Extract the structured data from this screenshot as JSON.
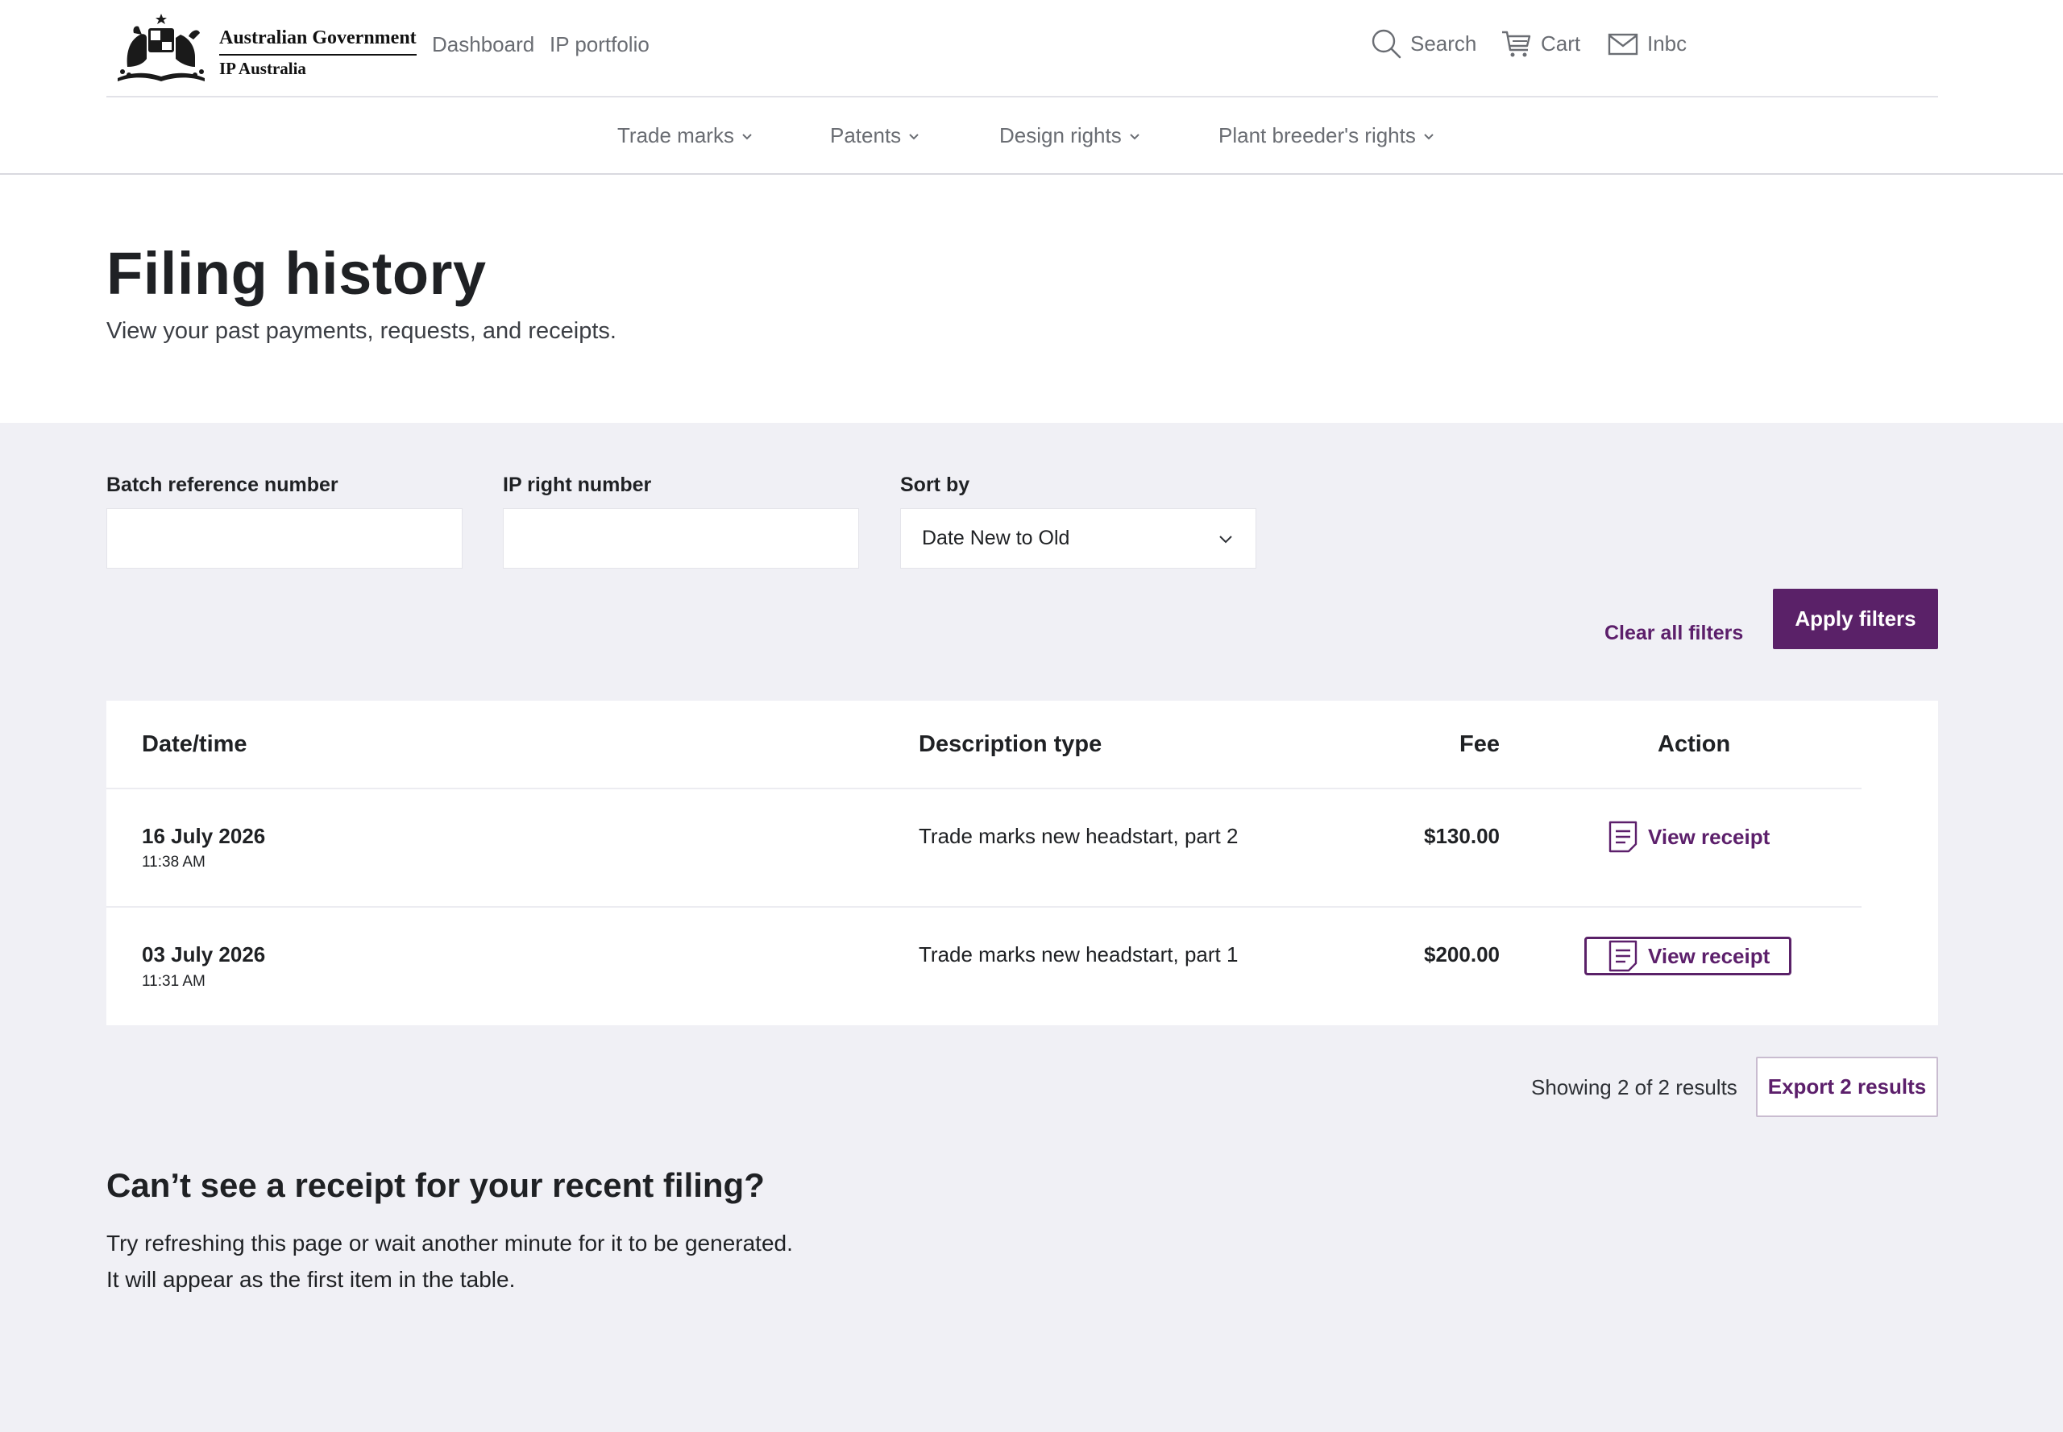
{
  "brand": {
    "line1": "Australian Government",
    "line2": "IP Australia",
    "crest_icon": "coat-of-arms"
  },
  "topnav": {
    "dashboard": "Dashboard",
    "portfolio": "IP portfolio",
    "search": "Search",
    "cart": "Cart",
    "inbox": "Inbc"
  },
  "mainnav": {
    "items": [
      {
        "label": "Trade marks",
        "icon": "chevron-down-icon"
      },
      {
        "label": "Patents",
        "icon": "chevron-down-icon"
      },
      {
        "label": "Design rights",
        "icon": "chevron-down-icon"
      },
      {
        "label": "Plant breeder's rights",
        "icon": "chevron-down-icon"
      }
    ]
  },
  "page": {
    "title": "Filing history",
    "subtitle": "View your past payments, requests, and receipts."
  },
  "filters": {
    "batch_label": "Batch reference number",
    "batch_value": "",
    "ip_label": "IP right number",
    "ip_value": "",
    "sort_label": "Sort by",
    "sort_value": "Date New to Old",
    "clear_label": "Clear all filters",
    "apply_label": "Apply filters"
  },
  "table": {
    "headers": {
      "date": "Date/time",
      "description": "Description type",
      "fee": "Fee",
      "action": "Action"
    },
    "rows": [
      {
        "date": "16 July 2026",
        "time": "11:38 AM",
        "description": "Trade marks new headstart, part 2",
        "fee": "$130.00",
        "action": "View receipt"
      },
      {
        "date": "03 July 2026",
        "time": "11:31 AM",
        "description": "Trade marks new headstart, part 1",
        "fee": "$200.00",
        "action": "View receipt"
      }
    ]
  },
  "results": {
    "showing": "Showing 2 of 2 results",
    "export_label": "Export 2 results"
  },
  "help": {
    "title": "Can’t see a receipt for your recent filing?",
    "line1": "Try refreshing this page or wait another minute for it to be generated.",
    "line2": "It will appear as the first item in the table."
  },
  "colors": {
    "accent": "#5a2168",
    "link": "#5c1f6b",
    "background": "#f0f0f5",
    "text": "#1f2124",
    "muted": "#6a6d73"
  }
}
